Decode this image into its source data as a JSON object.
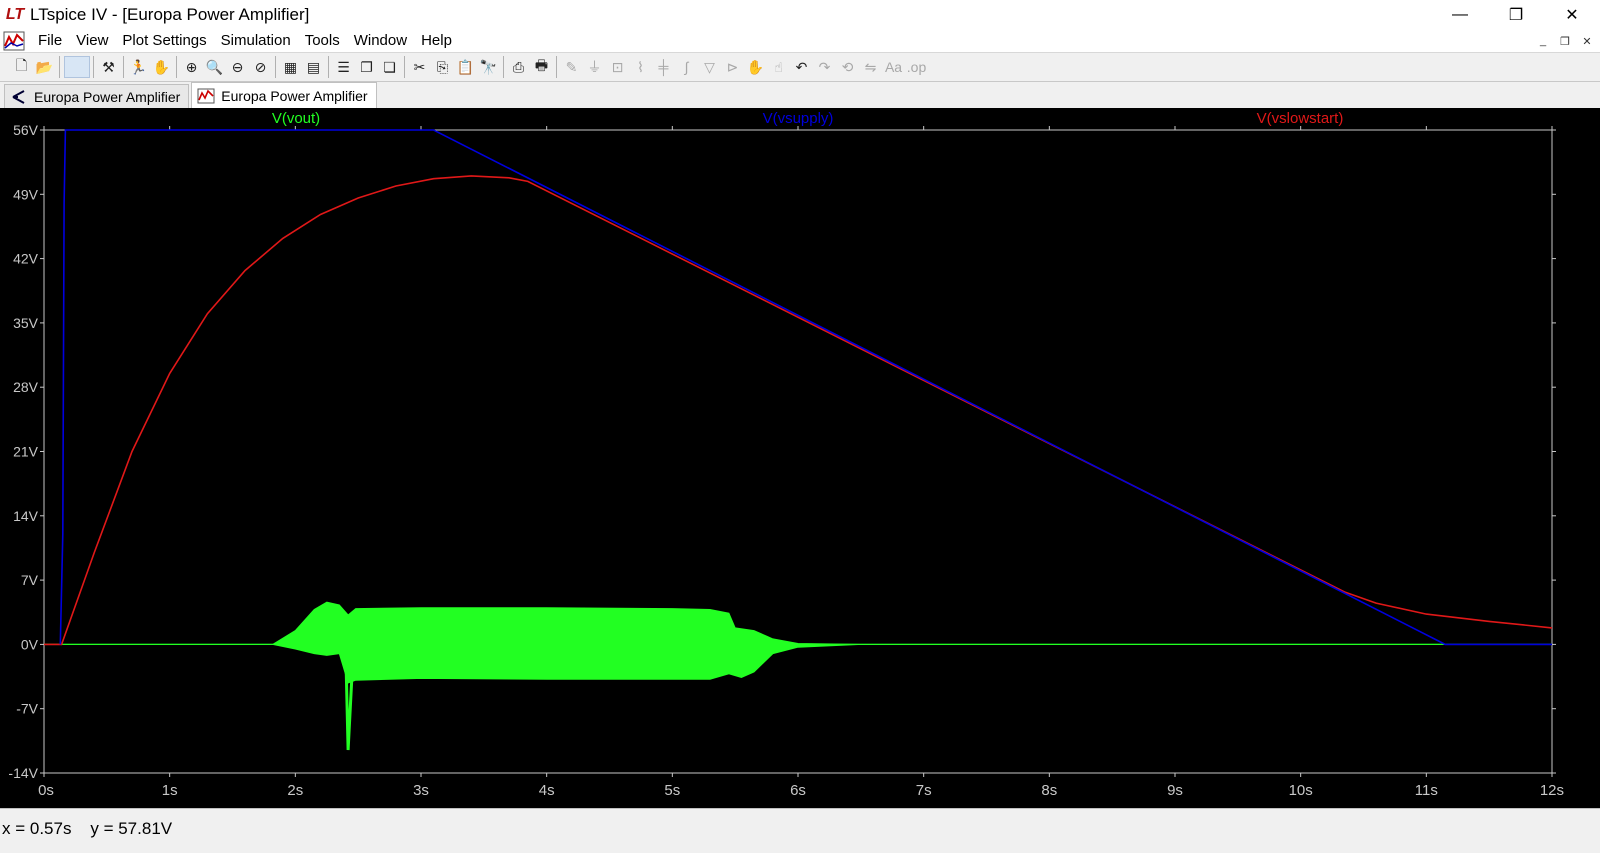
{
  "window": {
    "title": "LTspice IV - [Europa Power Amplifier]",
    "logo_text": "LT",
    "controls": [
      "minimize",
      "maximize",
      "close"
    ]
  },
  "menu": {
    "items": [
      "File",
      "View",
      "Plot Settings",
      "Simulation",
      "Tools",
      "Window",
      "Help"
    ]
  },
  "toolbar": {
    "buttons": [
      {
        "name": "new-schematic-icon",
        "glyph": "🗋",
        "dim": false
      },
      {
        "name": "open-icon",
        "glyph": "📂",
        "dim": false
      },
      {
        "sep": true
      },
      {
        "name": "blank-slot",
        "glyph": "",
        "blank": true
      },
      {
        "sep": true
      },
      {
        "name": "control-panel-icon",
        "glyph": "⚒",
        "dim": false
      },
      {
        "sep": true
      },
      {
        "name": "run-icon",
        "glyph": "🏃",
        "dim": false
      },
      {
        "name": "pan-hand-icon",
        "glyph": "✋",
        "dim": true
      },
      {
        "sep": true
      },
      {
        "name": "zoom-in-icon",
        "glyph": "⊕",
        "dim": false
      },
      {
        "name": "zoom-area-icon",
        "glyph": "🔍",
        "dim": false
      },
      {
        "name": "zoom-out-icon",
        "glyph": "⊖",
        "dim": false
      },
      {
        "name": "zoom-fit-icon",
        "glyph": "⊘",
        "dim": false
      },
      {
        "sep": true
      },
      {
        "name": "autorange-icon",
        "glyph": "▦",
        "dim": false
      },
      {
        "name": "plot-settings-icon",
        "glyph": "▤",
        "dim": false
      },
      {
        "sep": true
      },
      {
        "name": "tile-horizontal-icon",
        "glyph": "☰",
        "dim": false
      },
      {
        "name": "cascade-icon",
        "glyph": "❐",
        "dim": false
      },
      {
        "name": "tile-vertical-icon",
        "glyph": "❏",
        "dim": false
      },
      {
        "sep": true
      },
      {
        "name": "cut-icon",
        "glyph": "✂",
        "dim": false
      },
      {
        "name": "copy-icon",
        "glyph": "⎘",
        "dim": false
      },
      {
        "name": "paste-icon",
        "glyph": "📋",
        "dim": true
      },
      {
        "name": "find-icon",
        "glyph": "🔭",
        "dim": false
      },
      {
        "sep": true
      },
      {
        "name": "print-preview-icon",
        "glyph": "⎙",
        "dim": false
      },
      {
        "name": "print-icon",
        "glyph": "🖶",
        "dim": false
      },
      {
        "sep": true
      },
      {
        "name": "wire-icon",
        "glyph": "✎",
        "dim": true
      },
      {
        "name": "ground-icon",
        "glyph": "⏚",
        "dim": true
      },
      {
        "name": "label-icon",
        "glyph": "⊡",
        "dim": true
      },
      {
        "name": "resistor-icon",
        "glyph": "⌇",
        "dim": true
      },
      {
        "name": "capacitor-icon",
        "glyph": "╪",
        "dim": true
      },
      {
        "name": "inductor-icon",
        "glyph": "∫",
        "dim": true
      },
      {
        "name": "diode-icon",
        "glyph": "▽",
        "dim": true
      },
      {
        "name": "component-icon",
        "glyph": "⊳",
        "dim": true
      },
      {
        "name": "move-icon",
        "glyph": "✋",
        "dim": true
      },
      {
        "name": "drag-icon",
        "glyph": "☝",
        "dim": true
      },
      {
        "name": "undo-icon",
        "glyph": "↶",
        "dim": false
      },
      {
        "name": "redo-icon",
        "glyph": "↷",
        "dim": true
      },
      {
        "name": "rotate-icon",
        "glyph": "⟲",
        "dim": true
      },
      {
        "name": "mirror-icon",
        "glyph": "⇋",
        "dim": true
      },
      {
        "name": "text-icon",
        "glyph": "Aa",
        "dim": true
      },
      {
        "name": "spice-directive-icon",
        "glyph": ".op",
        "dim": true
      }
    ]
  },
  "tabs": [
    {
      "label": "Europa Power Amplifier",
      "icon": "schematic-tab-icon",
      "active": false
    },
    {
      "label": "Europa Power Amplifier",
      "icon": "waveform-tab-icon",
      "active": true
    }
  ],
  "status": {
    "text": "x = 0.57s    y = 57.81V"
  },
  "colors": {
    "plot_bg": "#000000",
    "axis": "#c8c8c8",
    "vout": "#22ff22",
    "vsupply": "#0000dd",
    "vslowstart": "#e01818"
  },
  "chart_data": {
    "type": "line",
    "xlim": [
      0,
      12
    ],
    "ylim": [
      -14,
      56
    ],
    "x_ticks": [
      "0s",
      "1s",
      "2s",
      "3s",
      "4s",
      "5s",
      "6s",
      "7s",
      "8s",
      "9s",
      "10s",
      "11s",
      "12s"
    ],
    "y_ticks": [
      "56V",
      "49V",
      "42V",
      "35V",
      "28V",
      "21V",
      "14V",
      "7V",
      "0V",
      "-7V",
      "-14V"
    ],
    "grid": false,
    "legend": "top",
    "series": [
      {
        "name": "V(vout)",
        "color": "#22ff22",
        "baseline": [
          [
            0,
            0
          ],
          [
            12,
            0
          ]
        ],
        "envelope_upper": [
          [
            0,
            0
          ],
          [
            1.82,
            0
          ],
          [
            2.0,
            1.5
          ],
          [
            2.15,
            3.8
          ],
          [
            2.25,
            4.6
          ],
          [
            2.35,
            4.3
          ],
          [
            2.42,
            3.2
          ],
          [
            2.48,
            3.9
          ],
          [
            3.0,
            4.0
          ],
          [
            4.0,
            4.0
          ],
          [
            5.0,
            3.9
          ],
          [
            5.3,
            3.8
          ],
          [
            5.45,
            3.4
          ],
          [
            5.5,
            1.8
          ],
          [
            5.65,
            1.5
          ],
          [
            5.8,
            0.6
          ],
          [
            6.0,
            0.1
          ],
          [
            6.5,
            0
          ],
          [
            12,
            0
          ]
        ],
        "envelope_lower": [
          [
            0,
            0
          ],
          [
            1.82,
            0
          ],
          [
            2.0,
            -0.5
          ],
          [
            2.15,
            -1.0
          ],
          [
            2.25,
            -1.2
          ],
          [
            2.35,
            -1.0
          ],
          [
            2.42,
            -4.2
          ],
          [
            2.48,
            -3.9
          ],
          [
            3.0,
            -3.7
          ],
          [
            4.0,
            -3.8
          ],
          [
            5.0,
            -3.8
          ],
          [
            5.3,
            -3.8
          ],
          [
            5.45,
            -3.2
          ],
          [
            5.55,
            -3.6
          ],
          [
            5.65,
            -3.0
          ],
          [
            5.8,
            -1.0
          ],
          [
            6.0,
            -0.3
          ],
          [
            6.5,
            0
          ],
          [
            12,
            0
          ]
        ],
        "spike": [
          [
            2.4,
            0
          ],
          [
            2.42,
            -11.5
          ],
          [
            2.45,
            -3.5
          ]
        ]
      },
      {
        "name": "V(vsupply)",
        "color": "#0000dd",
        "points": [
          [
            0.13,
            0
          ],
          [
            0.15,
            12
          ],
          [
            0.16,
            48
          ],
          [
            0.17,
            56
          ],
          [
            3.1,
            56
          ],
          [
            11.15,
            0
          ],
          [
            12,
            0
          ]
        ]
      },
      {
        "name": "V(vslowstart)",
        "color": "#e01818",
        "points": [
          [
            0,
            0
          ],
          [
            0.14,
            0
          ],
          [
            0.4,
            10
          ],
          [
            0.7,
            21
          ],
          [
            1.0,
            29.5
          ],
          [
            1.3,
            36
          ],
          [
            1.6,
            40.7
          ],
          [
            1.9,
            44.2
          ],
          [
            2.2,
            46.8
          ],
          [
            2.5,
            48.6
          ],
          [
            2.8,
            49.9
          ],
          [
            3.1,
            50.7
          ],
          [
            3.4,
            51.0
          ],
          [
            3.7,
            50.8
          ],
          [
            3.85,
            50.4
          ],
          [
            10.35,
            5.7
          ],
          [
            10.6,
            4.5
          ],
          [
            11.0,
            3.3
          ],
          [
            11.5,
            2.5
          ],
          [
            12.0,
            1.8
          ]
        ]
      }
    ]
  }
}
